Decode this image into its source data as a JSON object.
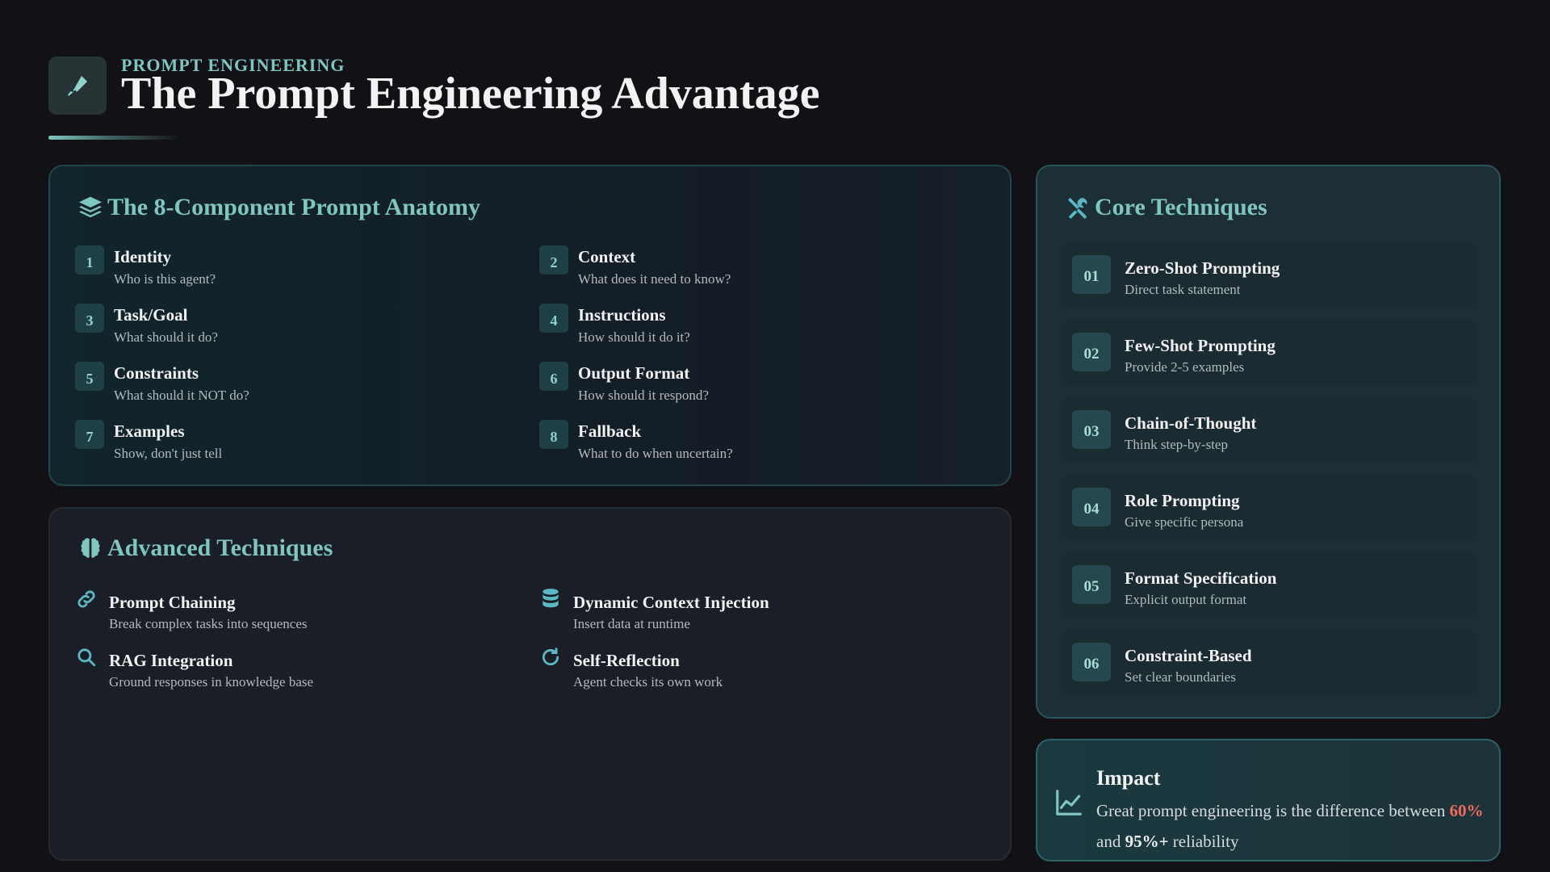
{
  "header": {
    "icon": "pen-icon",
    "eyebrow": "PROMPT ENGINEERING",
    "title": "The Prompt Engineering Advantage"
  },
  "anatomy": {
    "heading": "The 8-Component Prompt Anatomy",
    "icon": "layers-icon",
    "items": [
      {
        "num": "1",
        "title": "Identity",
        "sub": "Who is this agent?"
      },
      {
        "num": "2",
        "title": "Context",
        "sub": "What does it need to know?"
      },
      {
        "num": "3",
        "title": "Task/Goal",
        "sub": "What should it do?"
      },
      {
        "num": "4",
        "title": "Instructions",
        "sub": "How should it do it?"
      },
      {
        "num": "5",
        "title": "Constraints",
        "sub": "What should it NOT do?"
      },
      {
        "num": "6",
        "title": "Output Format",
        "sub": "How should it respond?"
      },
      {
        "num": "7",
        "title": "Examples",
        "sub": "Show, don't just tell"
      },
      {
        "num": "8",
        "title": "Fallback",
        "sub": "What to do when uncertain?"
      }
    ]
  },
  "advanced": {
    "heading": "Advanced Techniques",
    "icon": "brain-icon",
    "items": [
      {
        "icon": "link-icon",
        "title": "Prompt Chaining",
        "sub": "Break complex tasks into sequences"
      },
      {
        "icon": "database-icon",
        "title": "Dynamic Context Injection",
        "sub": "Insert data at runtime"
      },
      {
        "icon": "search-icon",
        "title": "RAG Integration",
        "sub": "Ground responses in knowledge base"
      },
      {
        "icon": "refresh-icon",
        "title": "Self-Reflection",
        "sub": "Agent checks its own work"
      }
    ]
  },
  "core": {
    "heading": "Core Techniques",
    "icon": "tools-icon",
    "items": [
      {
        "num": "01",
        "title": "Zero-Shot Prompting",
        "sub": "Direct task statement"
      },
      {
        "num": "02",
        "title": "Few-Shot Prompting",
        "sub": "Provide 2-5 examples"
      },
      {
        "num": "03",
        "title": "Chain-of-Thought",
        "sub": "Think step-by-step"
      },
      {
        "num": "04",
        "title": "Role Prompting",
        "sub": "Give specific persona"
      },
      {
        "num": "05",
        "title": "Format Specification",
        "sub": "Explicit output format"
      },
      {
        "num": "06",
        "title": "Constraint-Based",
        "sub": "Set clear boundaries"
      }
    ]
  },
  "impact": {
    "icon": "chart-line-icon",
    "title": "Impact",
    "text_before": "Great prompt engineering is the difference between ",
    "highlight_low": "60%",
    "text_middle": " and ",
    "highlight_high": "95%+",
    "text_after": " reliability"
  },
  "colors": {
    "background": "#111116",
    "accent": "#7fc6c0",
    "highlight_red": "#ef6b5e"
  }
}
